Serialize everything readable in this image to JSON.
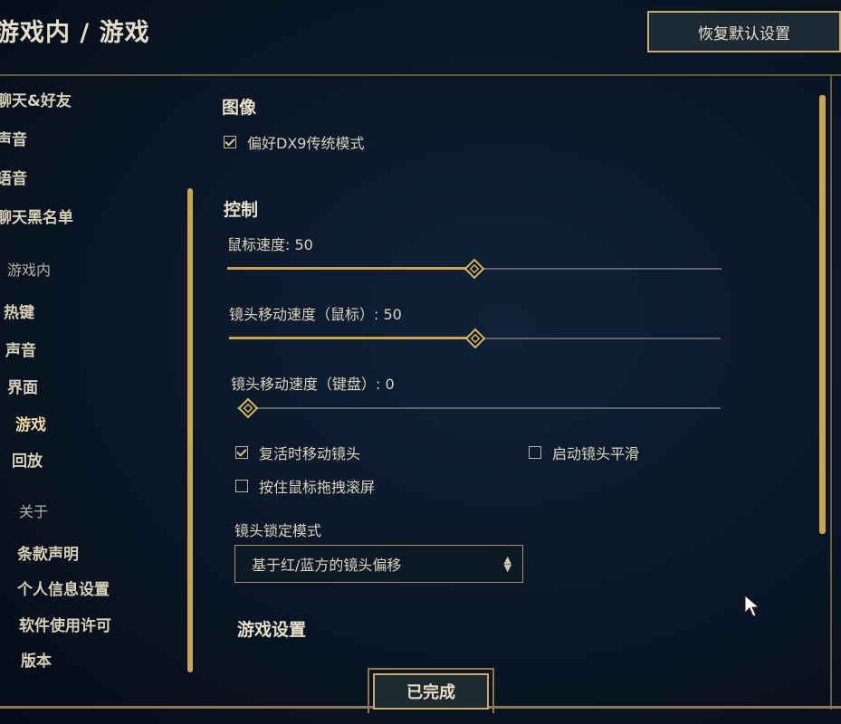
{
  "header": {
    "title": "游戏内 / 游戏",
    "reset_button": "恢复默认设置"
  },
  "sidebar": {
    "items": [
      {
        "label": "聊天&好友",
        "type": "item"
      },
      {
        "label": "声音",
        "type": "item"
      },
      {
        "label": "语音",
        "type": "item"
      },
      {
        "label": "聊天黑名单",
        "type": "item"
      },
      {
        "label": "游戏内",
        "type": "section"
      },
      {
        "label": "热键",
        "type": "item"
      },
      {
        "label": "声音",
        "type": "item"
      },
      {
        "label": "界面",
        "type": "item"
      },
      {
        "label": "游戏",
        "type": "item",
        "active": true
      },
      {
        "label": "回放",
        "type": "item"
      },
      {
        "label": "关于",
        "type": "section"
      },
      {
        "label": "条款声明",
        "type": "item"
      },
      {
        "label": "个人信息设置",
        "type": "item"
      },
      {
        "label": "软件使用许可",
        "type": "item"
      },
      {
        "label": "版本",
        "type": "item"
      }
    ]
  },
  "graphics": {
    "heading": "图像",
    "prefer_dx9": {
      "label": "偏好DX9传统模式",
      "checked": true
    }
  },
  "controls": {
    "heading": "控制",
    "mouse_speed": {
      "label": "鼠标速度: 50",
      "value": 50
    },
    "camera_speed_mouse": {
      "label": "镜头移动速度（鼠标）: 50",
      "value": 50
    },
    "camera_speed_keyboard": {
      "label": "镜头移动速度（键盘）: 0",
      "value": 0
    },
    "move_camera_on_revive": {
      "label": "复活时移动镜头",
      "checked": true
    },
    "camera_smoothing": {
      "label": "启动镜头平滑",
      "checked": false
    },
    "hold_drag_scroll": {
      "label": "按住鼠标拖拽滚屏",
      "checked": false
    },
    "camera_lock": {
      "label": "镜头锁定模式",
      "selected": "基于红/蓝方的镜头偏移"
    }
  },
  "game_settings": {
    "heading": "游戏设置"
  },
  "footer": {
    "done_button": "已完成"
  },
  "colors": {
    "accent_gold": "#c9a453",
    "background": "#0a1626",
    "text": "#ddd3bb"
  }
}
